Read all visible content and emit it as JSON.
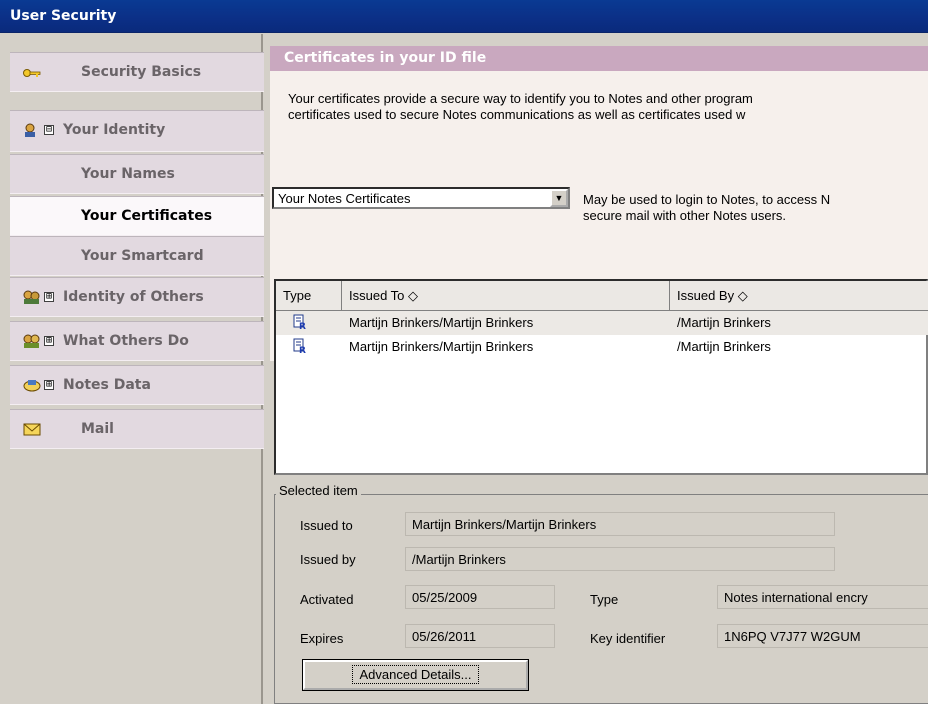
{
  "window": {
    "title": "User Security"
  },
  "sidebar": {
    "items": [
      {
        "label": "Security Basics",
        "icon": "key-icon",
        "expander": ""
      },
      {
        "label": "Your Identity",
        "icon": "identity-icon",
        "expander": "⊟"
      },
      {
        "label": "Your Names",
        "icon": "",
        "expander": ""
      },
      {
        "label": "Your Certificates",
        "icon": "",
        "expander": ""
      },
      {
        "label": "Your Smartcard",
        "icon": "",
        "expander": ""
      },
      {
        "label": "Identity of Others",
        "icon": "others-identity-icon",
        "expander": "⊞"
      },
      {
        "label": "What Others Do",
        "icon": "others-do-icon",
        "expander": "⊞"
      },
      {
        "label": "Notes Data",
        "icon": "notes-data-icon",
        "expander": "⊞"
      },
      {
        "label": "Mail",
        "icon": "mail-icon",
        "expander": ""
      }
    ],
    "active_item": "Your Certificates"
  },
  "main": {
    "section_title": "Certificates in your ID file",
    "intro_line1": "Your certificates provide a secure way to identify you to Notes and other program",
    "intro_line2": "certificates used to secure Notes communications as well as certificates used w",
    "select_value": "Your Notes Certificates",
    "select_note_line1": "May be used to login to Notes, to access N",
    "select_note_line2": "secure mail with other Notes users.",
    "table": {
      "headers": [
        "Type",
        "Issued To ◇",
        "Issued By ◇"
      ],
      "rows": [
        {
          "issued_to": "Martijn Brinkers/Martijn Brinkers",
          "issued_by": "/Martijn Brinkers",
          "selected": true
        },
        {
          "issued_to": "Martijn Brinkers/Martijn Brinkers",
          "issued_by": "/Martijn Brinkers",
          "selected": false
        }
      ]
    },
    "selected_item": {
      "legend": "Selected item",
      "issued_to_label": "Issued to",
      "issued_to_value": "Martijn Brinkers/Martijn Brinkers",
      "issued_by_label": "Issued by",
      "issued_by_value": "/Martijn Brinkers",
      "activated_label": "Activated",
      "activated_value": "05/25/2009",
      "expires_label": "Expires",
      "expires_value": "05/26/2011",
      "type_label": "Type",
      "type_value": "Notes international encry",
      "key_label": "Key identifier",
      "key_value": "1N6PQ V7J77 W2GUM",
      "advanced_button": "Advanced Details..."
    }
  },
  "colors": {
    "titlebar": "#0b2f86",
    "section_header": "#c9a8bf",
    "nav_bg": "#e2d9e0",
    "intro_bg": "#f6f0ec"
  }
}
